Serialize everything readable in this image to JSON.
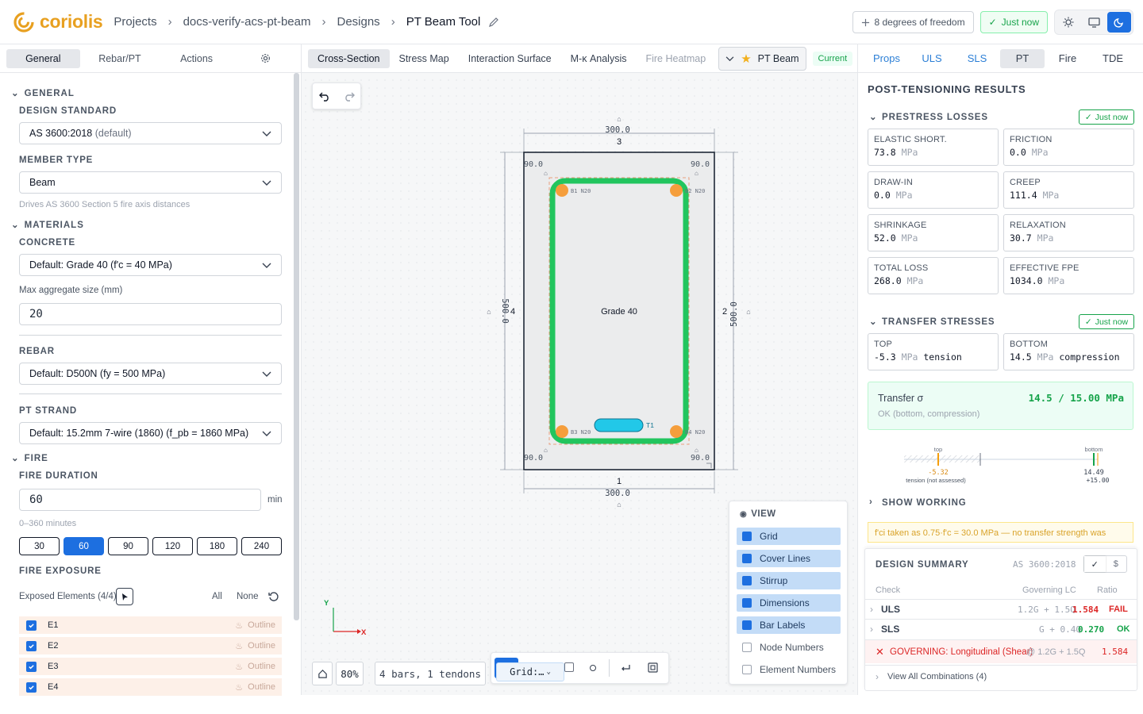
{
  "header": {
    "logo": "coriolis",
    "breadcrumbs": [
      "Projects",
      "docs-verify-acs-pt-beam",
      "Designs",
      "PT Beam Tool"
    ],
    "dof": "8 degrees of freedom",
    "saved": "Just now"
  },
  "left": {
    "tabs": [
      "General",
      "Rebar/PT",
      "Actions"
    ],
    "general_section": "GENERAL",
    "design_standard_label": "DESIGN STANDARD",
    "design_standard_value": "AS 3600:2018",
    "design_standard_suffix": "(default)",
    "member_type_label": "MEMBER TYPE",
    "member_type_value": "Beam",
    "member_type_hint": "Drives AS 3600 Section 5 fire axis distances",
    "materials_section": "MATERIALS",
    "concrete_label": "CONCRETE",
    "concrete_value": "Default: Grade 40 (f'c = 40 MPa)",
    "agg_label": "Max aggregate size (mm)",
    "agg_value": "20",
    "rebar_label": "REBAR",
    "rebar_value": "Default: D500N (fy = 500 MPa)",
    "pt_label": "PT STRAND",
    "pt_value": "Default: 15.2mm 7-wire (1860) (f_pb = 1860 MPa)",
    "fire_section": "FIRE",
    "fire_duration_label": "FIRE DURATION",
    "fire_duration_value": "60",
    "fire_duration_unit": "min",
    "fire_duration_hint": "0–360 minutes",
    "durations": [
      "30",
      "60",
      "90",
      "120",
      "180",
      "240"
    ],
    "selected_duration": "60",
    "exposure_label": "FIRE EXPOSURE",
    "exposed_label": "Exposed Elements (4/4)",
    "all": "All",
    "none": "None",
    "elements": [
      {
        "id": "E1",
        "mode": "Outline"
      },
      {
        "id": "E2",
        "mode": "Outline"
      },
      {
        "id": "E3",
        "mode": "Outline"
      },
      {
        "id": "E4",
        "mode": "Outline"
      }
    ]
  },
  "center": {
    "tabs": [
      "Cross-Section",
      "Stress Map",
      "Interaction Surface",
      "M-κ Analysis",
      "Fire Heatmap"
    ],
    "design_name": "PT Beam",
    "current": "Current",
    "section": {
      "width_label": "300.0",
      "height_label": "500.0",
      "edge_top": "3",
      "edge_right": "2",
      "edge_bottom": "1",
      "edge_left": "4",
      "corner_cover": "90.0",
      "material": "Grade 40",
      "bars": [
        "B1 N20",
        "B2 N20",
        "B3 N20",
        "B4 N20"
      ],
      "tendon": "T1"
    },
    "axis_x": "X",
    "axis_y": "Y",
    "zoom": "80%",
    "summary": "4 bars, 1 tendons",
    "grid_select": "Grid:…",
    "view": {
      "title": "VIEW",
      "items": [
        {
          "label": "Grid",
          "on": true
        },
        {
          "label": "Cover Lines",
          "on": true
        },
        {
          "label": "Stirrup",
          "on": true
        },
        {
          "label": "Dimensions",
          "on": true
        },
        {
          "label": "Bar Labels",
          "on": true
        },
        {
          "label": "Node Numbers",
          "on": false
        },
        {
          "label": "Element Numbers",
          "on": false
        }
      ]
    }
  },
  "right": {
    "tabs": [
      "Props",
      "ULS",
      "SLS",
      "PT",
      "Fire",
      "TDE"
    ],
    "active_tab": "PT",
    "heading": "POST-TENSIONING RESULTS",
    "losses_section": "PRESTRESS LOSSES",
    "just_now": "Just now",
    "losses": [
      {
        "label": "ELASTIC SHORT.",
        "value": "73.8",
        "unit": "MPa"
      },
      {
        "label": "FRICTION",
        "value": "0.0",
        "unit": "MPa"
      },
      {
        "label": "DRAW-IN",
        "value": "0.0",
        "unit": "MPa"
      },
      {
        "label": "CREEP",
        "value": "111.4",
        "unit": "MPa"
      },
      {
        "label": "SHRINKAGE",
        "value": "52.0",
        "unit": "MPa"
      },
      {
        "label": "RELAXATION",
        "value": "30.7",
        "unit": "MPa"
      },
      {
        "label": "TOTAL LOSS",
        "value": "268.0",
        "unit": "MPa"
      },
      {
        "label": "EFFECTIVE FPE",
        "value": "1034.0",
        "unit": "MPa"
      }
    ],
    "transfer_section": "TRANSFER STRESSES",
    "transfer": [
      {
        "label": "TOP",
        "value": "-5.3",
        "unit": "MPa",
        "state": "tension"
      },
      {
        "label": "BOTTOM",
        "value": "14.5",
        "unit": "MPa",
        "state": "compression"
      }
    ],
    "transfer_sigma_label": "Transfer σ",
    "transfer_sigma_value": "14.5 / 15.00 MPa",
    "transfer_sigma_status": "OK (bottom, compression)",
    "gauge": {
      "top_label": "top",
      "top_value": "-5.32",
      "top_note": "tension (not assessed)",
      "bottom_label": "bottom",
      "bottom_value": "14.49",
      "limit": "+15.00"
    },
    "show_working": "SHOW WORKING",
    "warning": "f'ci taken as 0.75·f'c = 30.0 MPa — no transfer strength was",
    "design_summary": {
      "title": "DESIGN SUMMARY",
      "standard": "AS 3600:2018",
      "cols": [
        "Check",
        "Governing LC",
        "Ratio"
      ],
      "rows": [
        {
          "check": "ULS",
          "lc": "1.2G + 1.5Q",
          "ratio": "1.584",
          "status": "FAIL"
        },
        {
          "check": "SLS",
          "lc": "G + 0.4Q",
          "ratio": "0.270",
          "status": "OK"
        }
      ],
      "governing": "GOVERNING: Longitudinal (Shear)",
      "governing_lc": "@ 1.2G + 1.5Q",
      "governing_ratio": "1.584",
      "view_all": "View All Combinations (4)"
    }
  },
  "colors": {
    "accent": "#1d6fe0",
    "logo": "#e8a020",
    "ok": "#16a34a",
    "fail": "#dc2626",
    "stirrup": "#22c55e",
    "bar": "#f59e3c",
    "tendon": "#22c8e8"
  }
}
